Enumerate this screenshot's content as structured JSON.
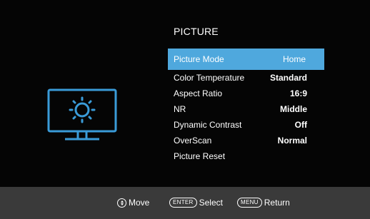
{
  "menu": {
    "title": "PICTURE",
    "items": [
      {
        "label": "Picture Mode",
        "value": "Home",
        "selected": true
      },
      {
        "label": "Color Temperature",
        "value": "Standard",
        "selected": false
      },
      {
        "label": "Aspect Ratio",
        "value": "16:9",
        "selected": false
      },
      {
        "label": "NR",
        "value": "Middle",
        "selected": false
      },
      {
        "label": "Dynamic Contrast",
        "value": "Off",
        "selected": false
      },
      {
        "label": "OverScan",
        "value": "Normal",
        "selected": false
      },
      {
        "label": "Picture Reset",
        "value": "",
        "selected": false
      }
    ]
  },
  "footer": {
    "move_label": "Move",
    "select_key": "ENTER",
    "select_label": "Select",
    "return_key": "MENU",
    "return_label": "Return"
  },
  "icons": {
    "category_icon": "monitor-brightness-icon",
    "move_key_icon": "up-down-navigation-icon"
  },
  "colors": {
    "accent": "#4fa8dd",
    "background": "#050505",
    "footer": "#3a3a3a",
    "text": "#ffffff"
  }
}
